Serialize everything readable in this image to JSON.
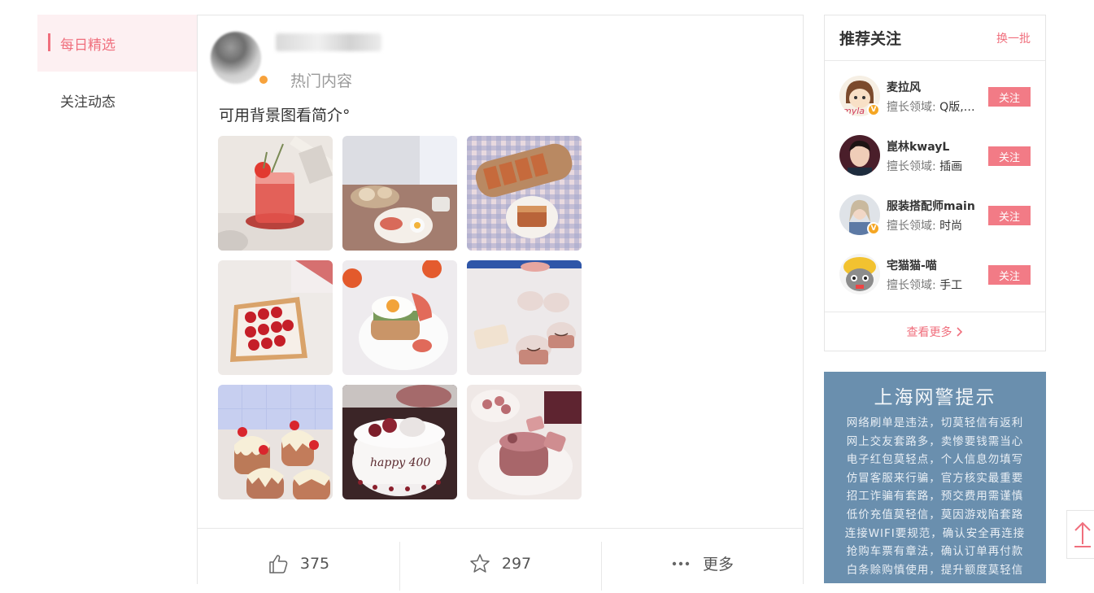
{
  "nav": {
    "items": [
      {
        "label": "每日精选",
        "active": true
      },
      {
        "label": "关注动态",
        "active": false
      }
    ]
  },
  "post": {
    "author_tag": "热门内容",
    "text": "可用背景图看简介°",
    "images": [
      "red-drink-icon",
      "breakfast-table-icon",
      "loaf-cake-icon",
      "strawberry-toast-icon",
      "egg-sandwich-icon",
      "smiley-cakes-icon",
      "cherry-cakes-icon",
      "birthday-cake-icon",
      "pink-dessert-icon"
    ],
    "actions": {
      "like_count": "375",
      "favorite_count": "297",
      "more_label": "更多"
    }
  },
  "recommend": {
    "title": "推荐关注",
    "refresh_label": "换一批",
    "field_prefix": "擅长领域: ",
    "follow_label": "关注",
    "more_label": "查看更多",
    "users": [
      {
        "name": "麦拉风",
        "field": "Q版,…",
        "verified": true
      },
      {
        "name": "崑林kwayL",
        "field": "插画",
        "verified": false
      },
      {
        "name": "服装搭配师main",
        "field": "时尚",
        "verified": true
      },
      {
        "name": "宅猫猫-喵",
        "field": "手工",
        "verified": false
      }
    ]
  },
  "notice": {
    "title": "上海网警提示",
    "lines": [
      "网络刷单是违法，切莫轻信有返利",
      "网上交友套路多，卖惨要钱需当心",
      "电子红包莫轻点，个人信息勿填写",
      "仿冒客服来行骗，官方核实最重要",
      "招工诈骗有套路，预交费用需谨慎",
      "低价充值莫轻信，莫因游戏陷套路",
      "连接WIFI要规范，确认安全再连接",
      "抢购车票有章法，确认订单再付款",
      "白条赊购慎使用，提升额度莫轻信"
    ]
  },
  "colors": {
    "accent": "#f06f7d",
    "follow_button": "#f27b86",
    "notice_bg": "#6a8fae"
  }
}
